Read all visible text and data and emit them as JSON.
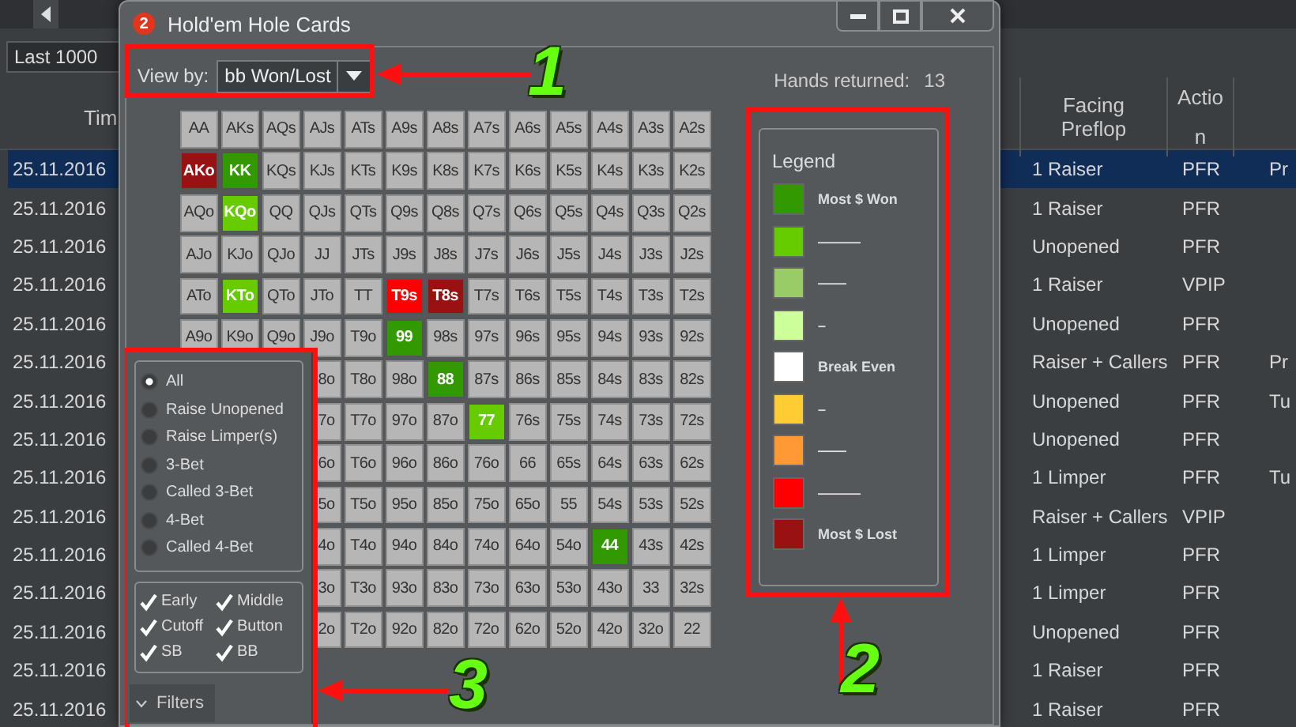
{
  "toolbar": {
    "range_dropdown": "Last 1000"
  },
  "table": {
    "columns": [
      "Tim",
      "Facing Preflop",
      "Action"
    ],
    "rows": [
      {
        "time": "25.11.2016",
        "facing_preflop": "1 Raiser",
        "action": "PFR",
        "column_4": "Pr",
        "selected": true
      },
      {
        "time": "25.11.2016",
        "facing_preflop": "1 Raiser",
        "action": "PFR",
        "selected": false
      },
      {
        "time": "25.11.2016",
        "facing_preflop": "Unopened",
        "action": "PFR",
        "selected": false
      },
      {
        "time": "25.11.2016",
        "facing_preflop": "1 Raiser",
        "action": "VPIP",
        "selected": false
      },
      {
        "time": "25.11.2016",
        "facing_preflop": "Unopened",
        "action": "PFR",
        "selected": false
      },
      {
        "time": "25.11.2016",
        "facing_preflop": "Raiser + Callers",
        "action": "PFR",
        "column_4": "Pr",
        "selected": false
      },
      {
        "time": "25.11.2016",
        "facing_preflop": "Unopened",
        "action": "PFR",
        "column_4": "Tu",
        "selected": false
      },
      {
        "time": "25.11.2016",
        "facing_preflop": "Unopened",
        "action": "PFR",
        "selected": false
      },
      {
        "time": "25.11.2016",
        "facing_preflop": "1 Limper",
        "action": "PFR",
        "column_4": "Tu",
        "selected": false
      },
      {
        "time": "25.11.2016",
        "facing_preflop": "Raiser + Callers",
        "action": "VPIP",
        "selected": false
      },
      {
        "time": "25.11.2016",
        "facing_preflop": "1 Limper",
        "action": "PFR",
        "selected": false
      },
      {
        "time": "25.11.2016",
        "facing_preflop": "1 Limper",
        "action": "PFR",
        "selected": false
      },
      {
        "time": "25.11.2016",
        "facing_preflop": "Unopened",
        "action": "PFR",
        "selected": false
      },
      {
        "time": "25.11.2016",
        "facing_preflop": "1 Raiser",
        "action": "PFR",
        "selected": false
      },
      {
        "time": "25.11.2016",
        "facing_preflop": "1 Raiser",
        "action": "PFR",
        "selected": false
      }
    ]
  },
  "dialog": {
    "badge": "2",
    "title": "Hold'em Hole Cards",
    "view_by": {
      "label": "View by:",
      "value": "bb Won/Lost"
    },
    "hands_returned": {
      "label": "Hands returned:",
      "value": "13"
    },
    "grid": [
      [
        "AA",
        "AKs",
        "AQs",
        "AJs",
        "ATs",
        "A9s",
        "A8s",
        "A7s",
        "A6s",
        "A5s",
        "A4s",
        "A3s",
        "A2s"
      ],
      [
        {
          "hand": "AKo",
          "color": "#991111"
        },
        {
          "hand": "KK",
          "color": "#339900"
        },
        "KQs",
        "KJs",
        "KTs",
        "K9s",
        "K8s",
        "K7s",
        "K6s",
        "K5s",
        "K4s",
        "K3s",
        "K2s"
      ],
      [
        "AQo",
        {
          "hand": "KQo",
          "color": "#66cc00"
        },
        "QQ",
        "QJs",
        "QTs",
        "Q9s",
        "Q8s",
        "Q7s",
        "Q6s",
        "Q5s",
        "Q4s",
        "Q3s",
        "Q2s"
      ],
      [
        "AJo",
        "KJo",
        "QJo",
        "JJ",
        "JTs",
        "J9s",
        "J8s",
        "J7s",
        "J6s",
        "J5s",
        "J4s",
        "J3s",
        "J2s"
      ],
      [
        "ATo",
        {
          "hand": "KTo",
          "color": "#66cc00"
        },
        "QTo",
        "JTo",
        "TT",
        {
          "hand": "T9s",
          "color": "#ff0000"
        },
        {
          "hand": "T8s",
          "color": "#991111"
        },
        "T7s",
        "T6s",
        "T5s",
        "T4s",
        "T3s",
        "T2s"
      ],
      [
        "A9o",
        "K9o",
        "Q9o",
        "J9o",
        "T9o",
        {
          "hand": "99",
          "color": "#339900"
        },
        "98s",
        "97s",
        "96s",
        "95s",
        "94s",
        "93s",
        "92s"
      ],
      [
        "8o",
        "T8o",
        "98o",
        {
          "hand": "88",
          "color": "#339900"
        },
        "87s",
        "86s",
        "85s",
        "84s",
        "83s",
        "82s"
      ],
      [
        "7o",
        "T7o",
        "97o",
        "87o",
        {
          "hand": "77",
          "color": "#66cc00"
        },
        "76s",
        "75s",
        "74s",
        "73s",
        "72s"
      ],
      [
        "6o",
        "T6o",
        "96o",
        "86o",
        "76o",
        "66",
        "65s",
        "64s",
        "63s",
        "62s"
      ],
      [
        "5o",
        "T5o",
        "95o",
        "85o",
        "75o",
        "65o",
        "55",
        "54s",
        "53s",
        "52s"
      ],
      [
        "4o",
        "T4o",
        "94o",
        "84o",
        "74o",
        "64o",
        "54o",
        {
          "hand": "44",
          "color": "#339900"
        },
        "43s",
        "42s"
      ],
      [
        "3o",
        "T3o",
        "93o",
        "83o",
        "73o",
        "63o",
        "53o",
        "43o",
        "33",
        "32s"
      ],
      [
        "2o",
        "T2o",
        "92o",
        "82o",
        "72o",
        "62o",
        "52o",
        "42o",
        "32o",
        "22"
      ]
    ],
    "legend": {
      "title": "Legend",
      "items": [
        {
          "label": "Most $ Won",
          "color": "#339900"
        },
        {
          "label": "———",
          "color": "#66cc00"
        },
        {
          "label": "——",
          "color": "#99cc66"
        },
        {
          "label": "–",
          "color": "#ccff99"
        },
        {
          "label": "Break Even",
          "color": "#ffffff"
        },
        {
          "label": "–",
          "color": "#ffcc33"
        },
        {
          "label": "——",
          "color": "#ff9933"
        },
        {
          "label": "———",
          "color": "#ff0000"
        },
        {
          "label": "Most $ Lost",
          "color": "#991111"
        }
      ]
    },
    "filters": {
      "actions": [
        {
          "label": "All",
          "selected": true
        },
        {
          "label": "Raise Unopened",
          "selected": false
        },
        {
          "label": "Raise Limper(s)",
          "selected": false
        },
        {
          "label": "3-Bet",
          "selected": false
        },
        {
          "label": "Called 3-Bet",
          "selected": false
        },
        {
          "label": "4-Bet",
          "selected": false
        },
        {
          "label": "Called 4-Bet",
          "selected": false
        }
      ],
      "positions": [
        {
          "label": "Early",
          "checked": true
        },
        {
          "label": "Middle",
          "checked": true
        },
        {
          "label": "Cutoff",
          "checked": true
        },
        {
          "label": "Button",
          "checked": true
        },
        {
          "label": "SB",
          "checked": true
        },
        {
          "label": "BB",
          "checked": true
        }
      ],
      "tab": "Filters"
    }
  },
  "annotations": [
    {
      "number": "1"
    },
    {
      "number": "2"
    },
    {
      "number": "3"
    }
  ]
}
